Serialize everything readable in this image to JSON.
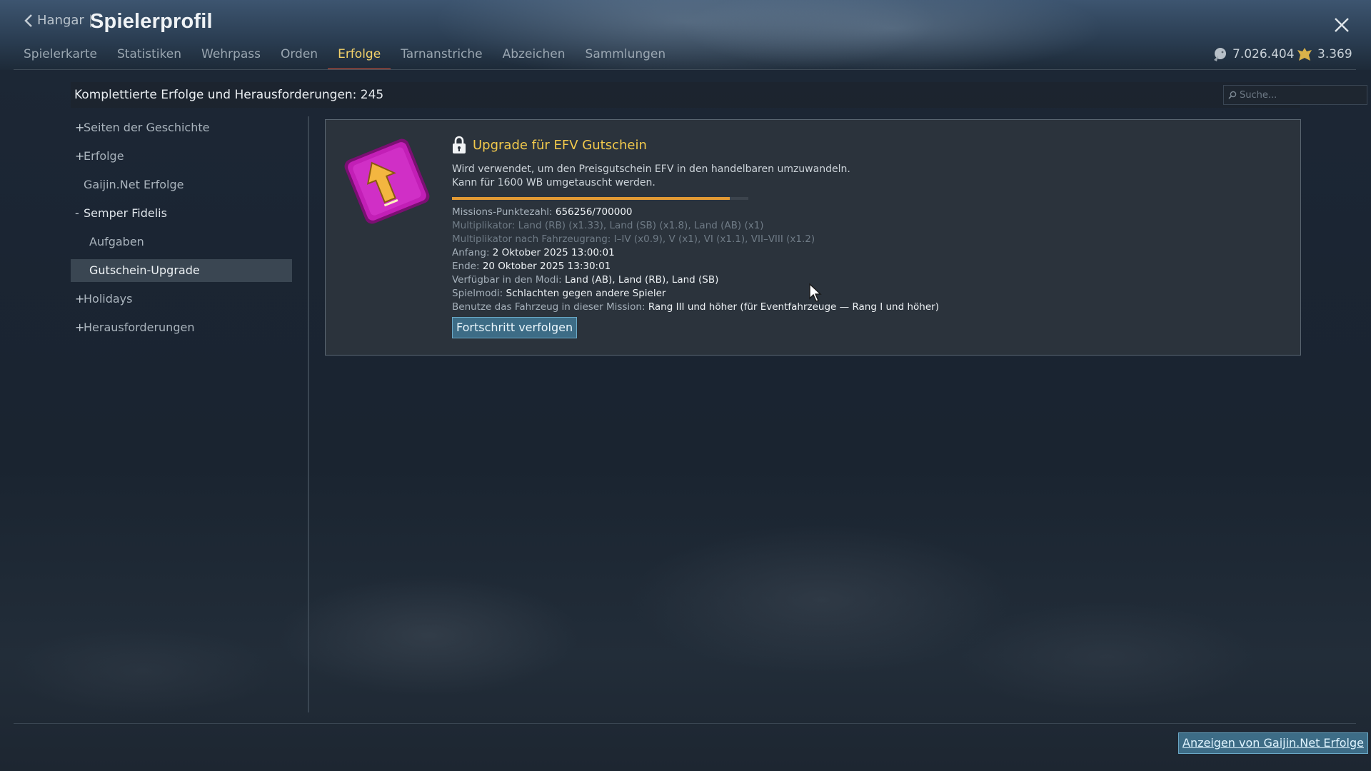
{
  "header": {
    "back_label": "Hangar",
    "separator": "|",
    "title": "Spielerprofil",
    "tabs": [
      {
        "label": "Spielerkarte",
        "active": false
      },
      {
        "label": "Statistiken",
        "active": false
      },
      {
        "label": "Wehrpass",
        "active": false
      },
      {
        "label": "Orden",
        "active": false
      },
      {
        "label": "Erfolge",
        "active": true
      },
      {
        "label": "Tarnanstriche",
        "active": false
      },
      {
        "label": "Abzeichen",
        "active": false
      },
      {
        "label": "Sammlungen",
        "active": false
      }
    ],
    "silver_lions": "7.026.404",
    "golden_eagles": "3.369"
  },
  "summary": {
    "text": "Komplettierte Erfolge und Herausforderungen: 245",
    "search_placeholder": "Suche..."
  },
  "sidebar": {
    "items": [
      {
        "prefix": "+",
        "label": "Seiten der Geschichte"
      },
      {
        "prefix": "+",
        "label": "Erfolge"
      },
      {
        "prefix": "",
        "label": "Gaijin.Net Erfolge"
      },
      {
        "prefix": "-",
        "label": "Semper Fidelis"
      },
      {
        "prefix": "",
        "label": "Aufgaben"
      },
      {
        "prefix": "",
        "label": "Gutschein-Upgrade"
      },
      {
        "prefix": "+",
        "label": "Holidays"
      },
      {
        "prefix": "+",
        "label": "Herausforderungen"
      }
    ]
  },
  "card": {
    "title": "Upgrade für EFV Gutschein",
    "description_line1": "Wird verwendet, um den Preisgutschein EFV in den handelbaren umzuwandeln.",
    "description_line2": "Kann für 1600 WB umgetauscht werden.",
    "progress_fraction": 0.9375,
    "rows": [
      {
        "key": "Missions-Punktezahl: ",
        "value": "656256/700000"
      },
      {
        "key": "Multiplikator: Land (RB) (x1.33), Land (SB) (x1.8), Land (AB) (x1)",
        "value": ""
      },
      {
        "key": "Multiplikator nach Fahrzeugrang: I–IV (x0.9), V (x1), VI (x1.1), VII–VIII (x1.2)",
        "value": ""
      },
      {
        "key": "Anfang: ",
        "value": "2 Oktober 2025 13:00:01"
      },
      {
        "key": "Ende: ",
        "value": "20 Oktober 2025 13:30:01"
      },
      {
        "key": "Verfügbar in den Modi: ",
        "value": "Land (AB), Land (RB), Land (SB)"
      },
      {
        "key": "Spielmodi: ",
        "value": "Schlachten gegen andere Spieler"
      },
      {
        "key": "Benutze das Fahrzeug in dieser Mission: ",
        "value": "Rang III und höher (für Eventfahrzeuge — Rang I und höher)"
      }
    ],
    "track_button": "Fortschritt verfolgen"
  },
  "footer": {
    "gaijin_button": "Anzeigen von Gaijin.Net Erfolge"
  },
  "colors": {
    "accent_yellow": "#f2c94c",
    "tab_underline": "#e8573a",
    "progress": "#e39a34",
    "button_bg": "#3d6c86",
    "badge_magenta": "#c21fb6"
  },
  "icons": [
    "back-chevron-icon",
    "close-icon",
    "silver-lion-icon",
    "golden-eagle-icon",
    "search-icon",
    "lock-icon",
    "upgrade-arrow-badge-icon",
    "mouse-cursor-icon"
  ]
}
